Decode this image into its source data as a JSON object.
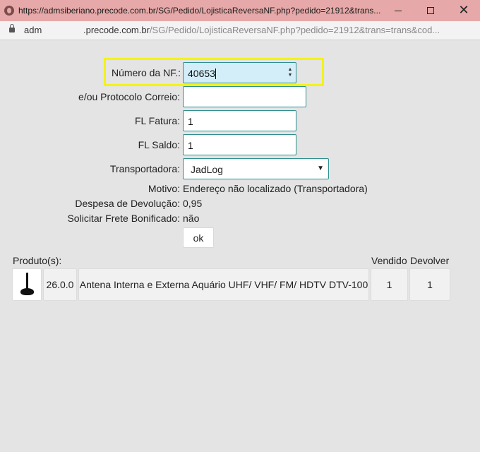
{
  "window": {
    "title": "https://admsiberiano.precode.com.br/SG/Pedido/LojisticaReversaNF.php?pedido=21912&trans...",
    "minimize_icon": "minimize-icon",
    "maximize_icon": "maximize-icon",
    "close_icon": "close-icon"
  },
  "address_bar": {
    "user": "adm",
    "domain": ".precode.com.br",
    "path": "/SG/Pedido/LojisticaReversaNF.php?pedido=21912&trans=trans&cod..."
  },
  "form": {
    "numero_nf": {
      "label": "Número da NF.:",
      "value": "40653"
    },
    "protocolo": {
      "label": "e/ou Protocolo Correio:",
      "value": ""
    },
    "fl_fatura": {
      "label": "FL Fatura:",
      "value": "1"
    },
    "fl_saldo": {
      "label": "FL Saldo:",
      "value": "1"
    },
    "transportadora": {
      "label": "Transportadora:",
      "value": "JadLog"
    },
    "motivo": {
      "label": "Motivo:",
      "value": "Endereço não localizado (Transportadora)"
    },
    "despesa": {
      "label": "Despesa de Devolução:",
      "value": "0,95"
    },
    "frete": {
      "label": "Solicitar Frete Bonificado:",
      "value": "não"
    },
    "ok_label": "ok"
  },
  "products": {
    "header_label": "Produto(s):",
    "col_vendido": "Vendido",
    "col_devolver": "Devolver",
    "rows": [
      {
        "code": "26.0.0",
        "name": "Antena Interna e Externa Aquário UHF/ VHF/ FM/ HDTV DTV-100",
        "vendido": "1",
        "devolver": "1",
        "image_icon": "antenna-icon"
      }
    ]
  },
  "colors": {
    "titlebar": "#e6a8a8",
    "highlight": "#f2f21a",
    "input_border": "#2e8f8f",
    "active_input": "#d3eef8"
  }
}
